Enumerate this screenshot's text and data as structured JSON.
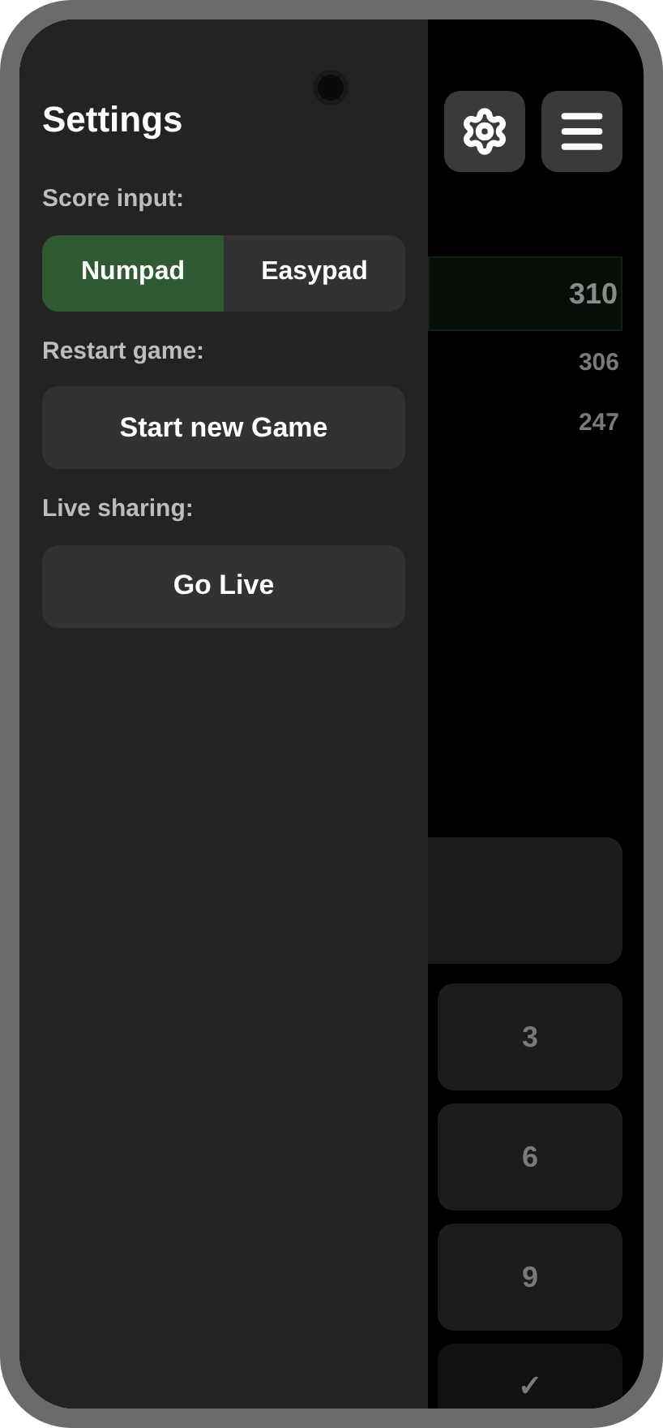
{
  "settings": {
    "title": "Settings",
    "sections": [
      {
        "kind": "segmented",
        "label": "Score input:",
        "options": [
          {
            "label": "Numpad",
            "selected": true
          },
          {
            "label": "Easypad",
            "selected": false
          }
        ]
      },
      {
        "kind": "button",
        "label": "Restart game:",
        "button": "Start new Game"
      },
      {
        "kind": "button",
        "label": "Live sharing:",
        "button": "Go Live"
      }
    ]
  },
  "scores": [
    {
      "value": "310",
      "selected": true
    },
    {
      "value": "306",
      "selected": false
    },
    {
      "value": "247",
      "selected": false
    }
  ],
  "keypad": [
    {
      "label": "3"
    },
    {
      "label": "6"
    },
    {
      "label": "9"
    },
    {
      "label": "✓"
    }
  ]
}
